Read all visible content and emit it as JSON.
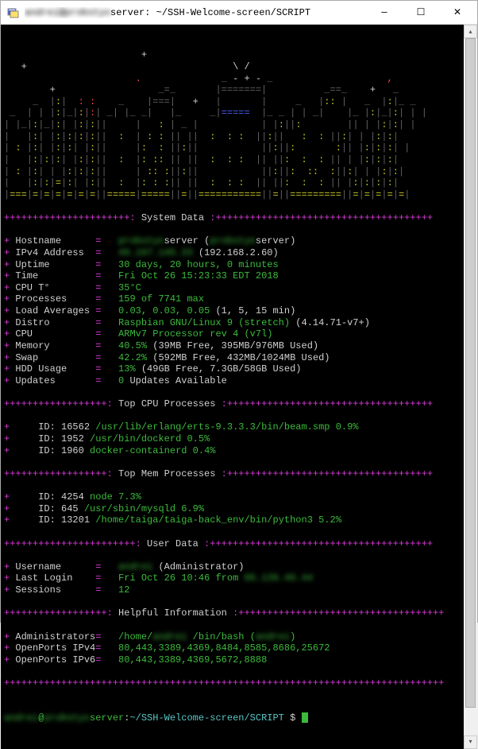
{
  "window": {
    "title_user": "andrei",
    "title_host": "@probstyo",
    "title_path": "server: ~/SSH-Welcome-screen/SCRIPT"
  },
  "sections": {
    "system_data": " System Data ",
    "top_cpu": " Top CPU Processes ",
    "top_mem": " Top Mem Processes ",
    "user_data": " User Data ",
    "helpful": " Helpful Information "
  },
  "sys": [
    {
      "label": "Hostname",
      "priv": "probstyo",
      "pub": "server (",
      "suffix": "server)",
      "priv2": "probstyo"
    },
    {
      "label": "IPv4 Address",
      "priv": "49.197.145.33",
      "pub": " (192.168.2.60)"
    },
    {
      "label": "Uptime",
      "val": "30 days, 20 hours, 0 minutes"
    },
    {
      "label": "Time",
      "val": "Fri Oct 26 15:23:33 EDT 2018"
    },
    {
      "label": "CPU T°",
      "val": "35°C"
    },
    {
      "label": "Processes",
      "val": "159 of 7741 max"
    },
    {
      "label": "Load Averages",
      "val": "0.03, 0.03, 0.05",
      "note": " (1, 5, 15 min)"
    },
    {
      "label": "Distro",
      "val": "Raspbian GNU/Linux 9 (stretch)",
      "note": " (4.14.71-v7+)"
    },
    {
      "label": "CPU",
      "val": "ARMv7 Processor rev 4 (v7l)"
    },
    {
      "label": "Memory",
      "val": "40.5%",
      "note": " (39MB Free, 395MB/976MB Used)"
    },
    {
      "label": "Swap",
      "val": "42.2%",
      "note": " (592MB Free, 432MB/1024MB Used)"
    },
    {
      "label": "HDD Usage",
      "val": "13%",
      "note": " (49GB Free, 7.3GB/58GB Used)"
    },
    {
      "label": "Updates",
      "val": "0",
      "note": " Updates Available"
    }
  ],
  "top_cpu": [
    {
      "label": "ID:",
      "pid": "16562",
      "cmd": "/usr/lib/erlang/erts-9.3.3.3/bin/beam.smp",
      "pct": "0.9%"
    },
    {
      "label": "ID:",
      "pid": "1952",
      "cmd": "/usr/bin/dockerd",
      "pct": "0.5%"
    },
    {
      "label": "ID:",
      "pid": "1960",
      "cmd": "docker-containerd",
      "pct": "0.4%"
    }
  ],
  "top_mem": [
    {
      "label": "ID:",
      "pid": "4254",
      "cmd": "node",
      "pct": "7.3%"
    },
    {
      "label": "ID:",
      "pid": "645",
      "cmd": "/usr/sbin/mysqld",
      "pct": "6.9%"
    },
    {
      "label": "ID:",
      "pid": "13201",
      "cmd": "/home/taiga/taiga-back_env/bin/python3",
      "pct": "5.2%"
    }
  ],
  "user": [
    {
      "label": "Username",
      "priv": "andrei",
      "note": " (Administrator)"
    },
    {
      "label": "Last Login",
      "val": "Fri Oct 26 10:46 from ",
      "priv": "99.139.49.44"
    },
    {
      "label": "Sessions",
      "val": "12"
    }
  ],
  "help": [
    {
      "label": "Administrators",
      "val": "/home/",
      "priv": "andrei",
      "val2": " /bin/bash (",
      "priv2": "andrei",
      "val3": ")"
    },
    {
      "label": "OpenPorts IPv4",
      "val": "80,443,3389,4369,8484,8585,8686,25672"
    },
    {
      "label": "OpenPorts IPv6",
      "val": "80,443,3389,4369,5672,8888"
    }
  ],
  "prompt": {
    "user": "andrei",
    "at": "@",
    "host": "probstyo",
    "host2": "server",
    "path": "~/SSH-Welcome-screen/SCRIPT",
    "sym": " $ "
  }
}
